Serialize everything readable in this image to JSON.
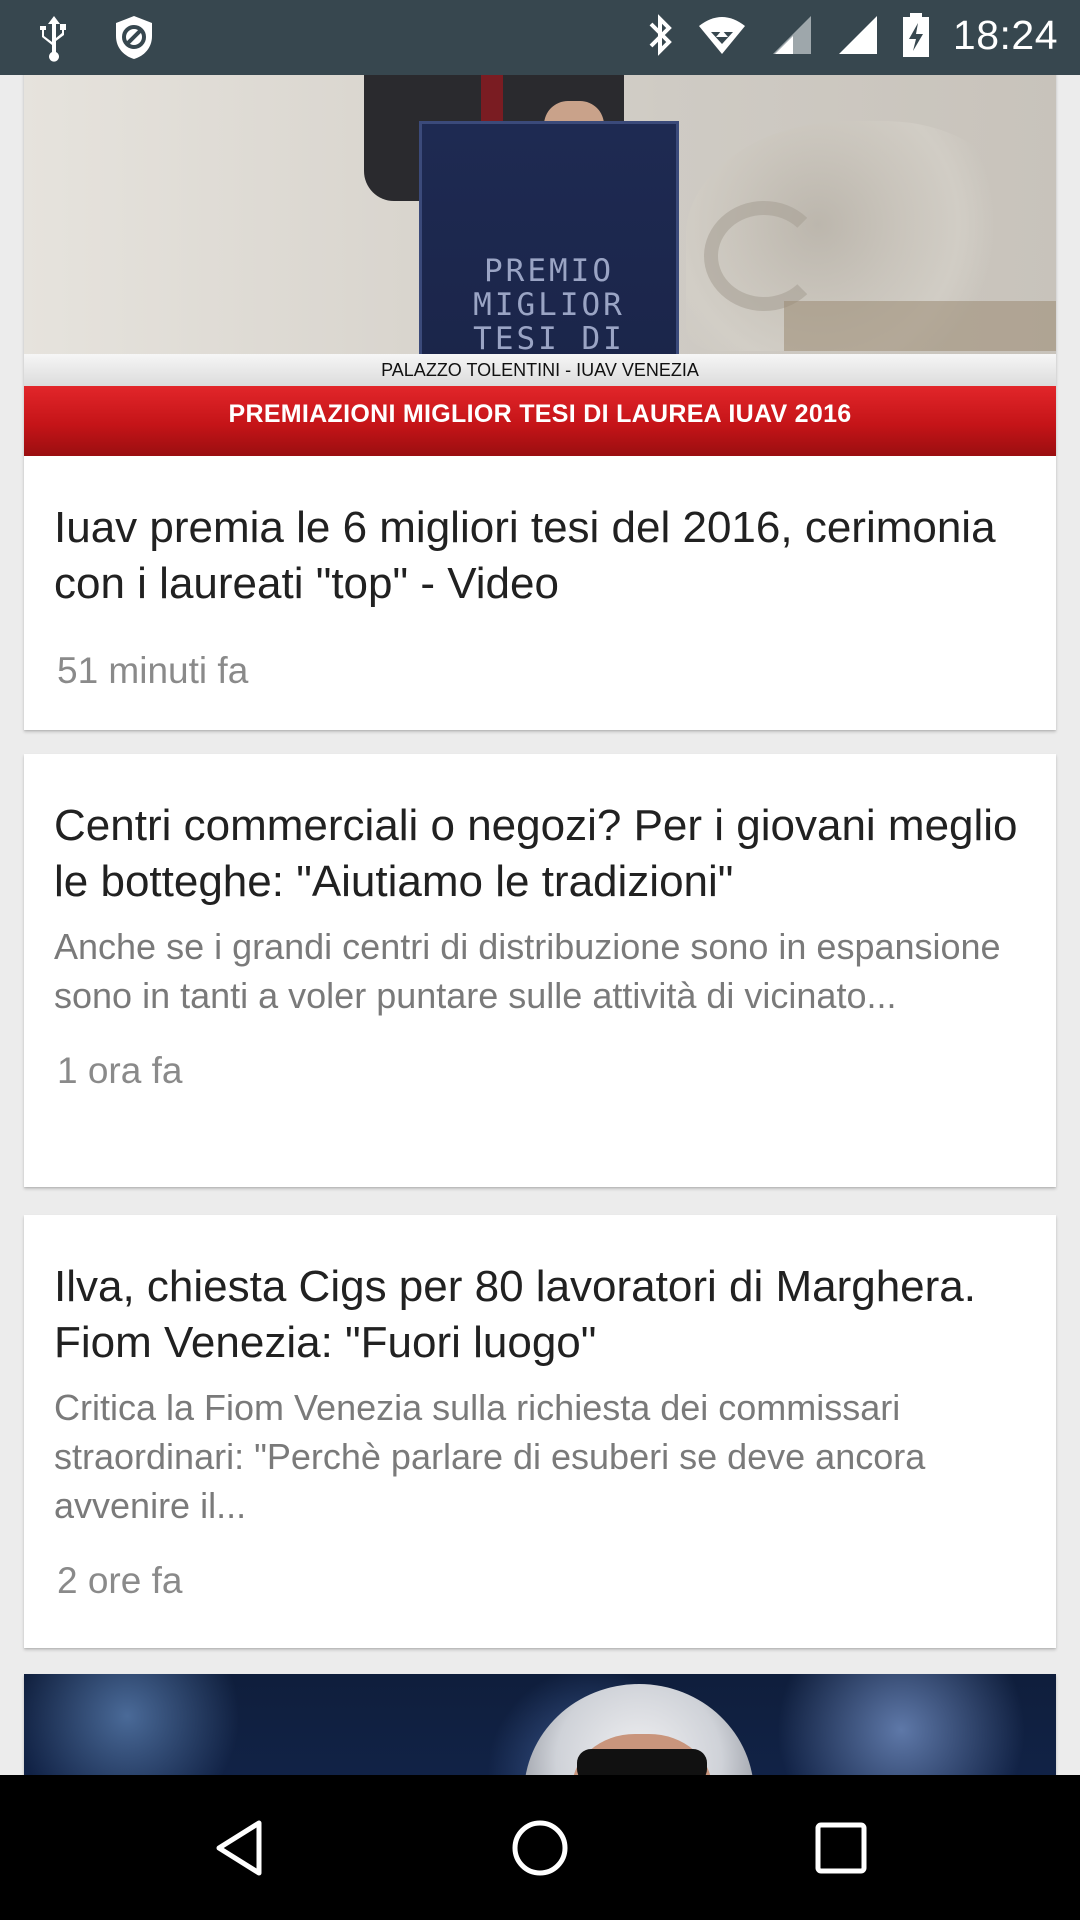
{
  "status_bar": {
    "time": "18:24",
    "icons_left": [
      "usb-icon",
      "block-icon"
    ],
    "icons_right": [
      "bluetooth-icon",
      "wifi-icon",
      "signal-icon",
      "signal-icon",
      "battery-charging-icon"
    ],
    "background": "#37474f"
  },
  "feed": {
    "articles": [
      {
        "image": {
          "podium_text": "PREMIO\nMIGLIOR\nTESI DI\nLAUREA",
          "caption_top": "PALAZZO TOLENTINI - IUAV VENEZIA",
          "caption_main": "PREMIAZIONI MIGLIOR TESI DI LAUREA IUAV 2016"
        },
        "title": "Iuav premia le 6 migliori tesi del 2016, cerimonia con i laureati \"top\" - Video",
        "time": "51 minuti fa"
      },
      {
        "title": "Centri commerciali o negozi? Per i giovani meglio le botteghe: \"Aiutiamo le tradizioni\"",
        "description": "Anche se i grandi centri di distribuzione sono in espansione sono in tanti a voler puntare sulle attività di vicinato...",
        "time": "1 ora fa"
      },
      {
        "title": "Ilva, chiesta Cigs per 80 lavoratori di Marghera. Fiom Venezia: \"Fuori luogo\"",
        "description": "Critica la Fiom Venezia sulla richiesta dei commissari straordinari: \"Perchè parlare di esuberi se deve ancora avvenire il...",
        "time": "2 ore fa"
      }
    ]
  },
  "nav_bar": {
    "buttons": [
      "back-icon",
      "home-icon",
      "recents-icon"
    ]
  },
  "colors": {
    "title": "#212121",
    "description": "#7a7a7a",
    "time": "#8a8a8a",
    "banner_red": "#c51418"
  }
}
